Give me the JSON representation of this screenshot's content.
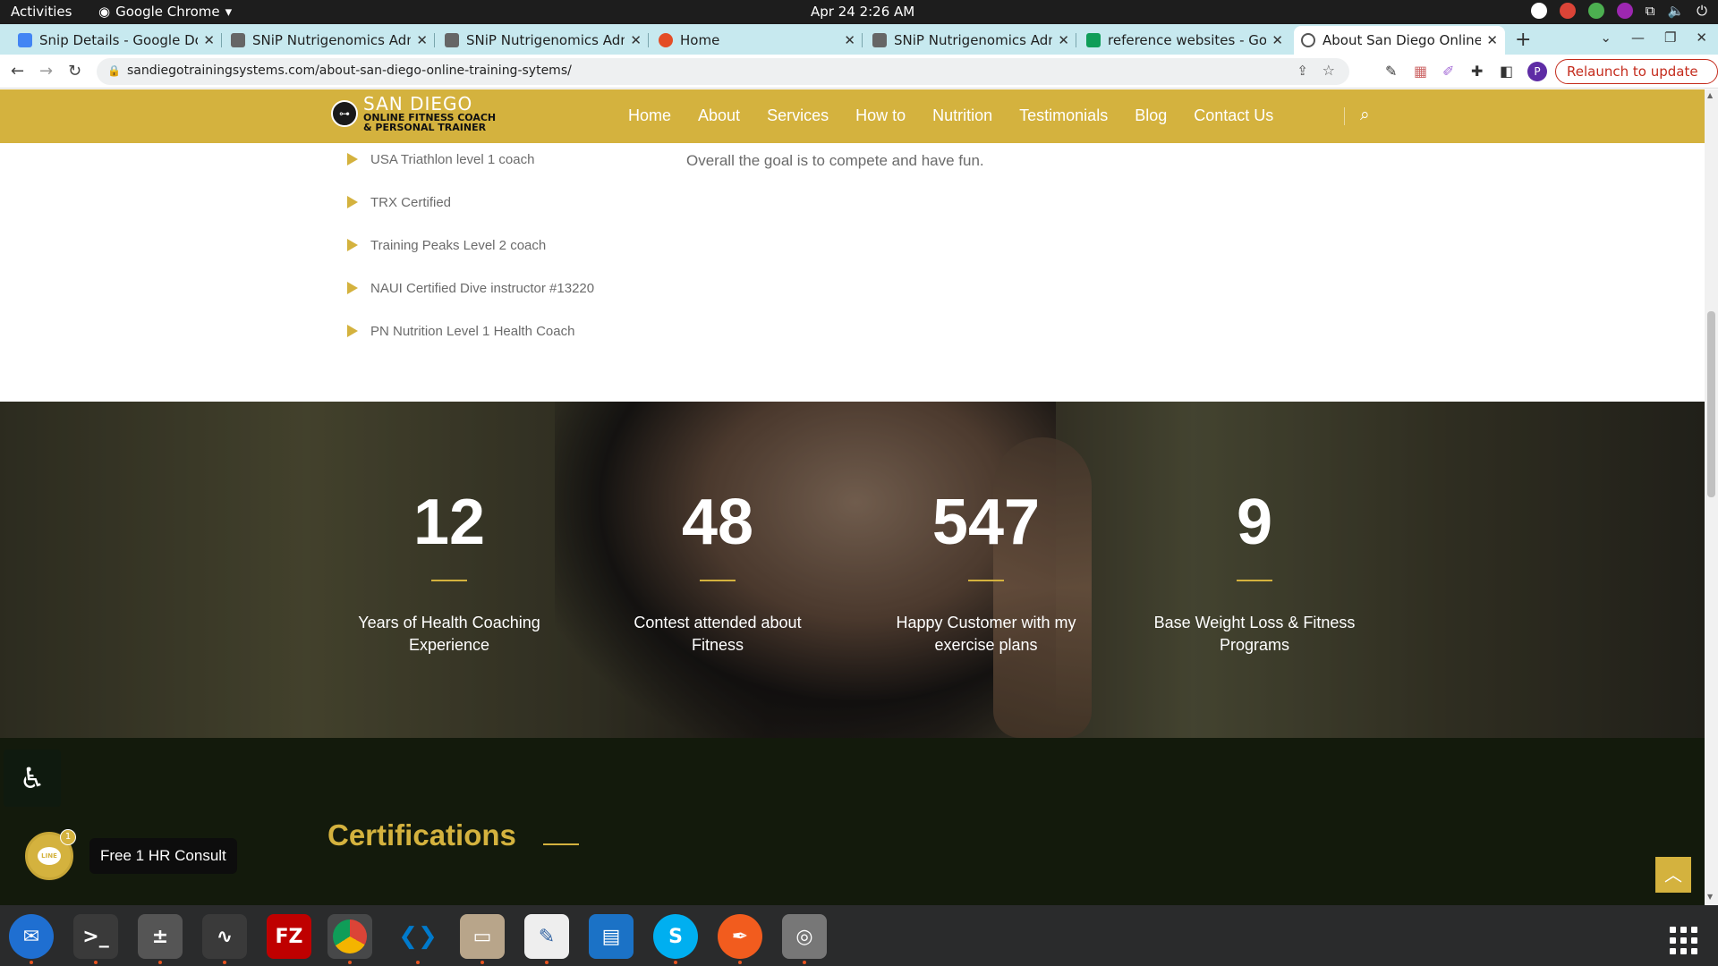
{
  "system_bar": {
    "activities": "Activities",
    "app_name": "Google Chrome",
    "datetime": "Apr 24  2:26 AM"
  },
  "tabs": [
    {
      "title": "Snip Details - Google Doc",
      "icon_color": "#4285f4",
      "icon": "docs-icon"
    },
    {
      "title": "SNiP Nutrigenomics Adm",
      "icon_color": "#666666",
      "icon": "snip-icon"
    },
    {
      "title": "SNiP Nutrigenomics Adm",
      "icon_color": "#666666",
      "icon": "snip-icon"
    },
    {
      "title": "Home",
      "icon_color": "#e44d26",
      "icon": "home-site-icon"
    },
    {
      "title": "SNiP Nutrigenomics Adm",
      "icon_color": "#666666",
      "icon": "snip-icon"
    },
    {
      "title": "reference websites - Goog",
      "icon_color": "#0f9d58",
      "icon": "sheets-icon"
    },
    {
      "title": "About San Diego Online T",
      "icon_color": "#555555",
      "icon": "globe-icon",
      "active": true
    }
  ],
  "address_bar": {
    "url": "sandiegotrainingsystems.com/about-san-diego-online-training-sytems/",
    "profile_initial": "P",
    "relaunch": "Relaunch to update"
  },
  "site": {
    "logo_name": "SAN DIEGO",
    "logo_sub1": "ONLINE FITNESS COACH",
    "logo_sub2": "& PERSONAL TRAINER",
    "menu": [
      "Home",
      "About",
      "Services",
      "How to",
      "Nutrition",
      "Testimonials",
      "Blog",
      "Contact Us"
    ],
    "accent_color": "#d4b23e"
  },
  "credentials": [
    "USA Triathlon level 1 coach",
    "TRX Certified",
    "Training Peaks Level 2 coach",
    "NAUI Certified Dive instructor #13220",
    "PN Nutrition Level 1 Health Coach"
  ],
  "goal_text": "Overall the goal is to compete and have fun.",
  "stats": [
    {
      "number": "12",
      "label": "Years of Health Coaching Experience"
    },
    {
      "number": "48",
      "label": "Contest attended about Fitness"
    },
    {
      "number": "547",
      "label": "Happy Customer with my exercise plans"
    },
    {
      "number": "9",
      "label": "Base Weight Loss & Fitness Programs"
    }
  ],
  "certifications_title": "Certifications",
  "widgets": {
    "line_label": "LINE",
    "line_badge": "1",
    "consult": "Free 1 HR Consult"
  },
  "dock": [
    {
      "name": "thunderbird-icon",
      "color": "#1f6fd1",
      "glyph": "✉"
    },
    {
      "name": "terminal-icon",
      "color": "#3a3a3a",
      "glyph": ">_"
    },
    {
      "name": "calculator-icon",
      "color": "#f0a500",
      "glyph": "±"
    },
    {
      "name": "system-monitor-icon",
      "color": "#3a3a3a",
      "glyph": "∿"
    },
    {
      "name": "filezilla-icon",
      "color": "#bf0000",
      "glyph": "FZ"
    },
    {
      "name": "chrome-icon",
      "color": "#db4437",
      "glyph": "◉"
    },
    {
      "name": "vscode-icon",
      "color": "#007acc",
      "glyph": "❮❯"
    },
    {
      "name": "files-icon",
      "color": "#b8a58a",
      "glyph": "▭"
    },
    {
      "name": "text-editor-icon",
      "color": "#f2f2f2",
      "glyph": "✎"
    },
    {
      "name": "libreoffice-writer-icon",
      "color": "#1b72c6",
      "glyph": "▤"
    },
    {
      "name": "skype-icon",
      "color": "#00aff0",
      "glyph": "S"
    },
    {
      "name": "inkscape-icon",
      "color": "#f25c1e",
      "glyph": "✒"
    },
    {
      "name": "disk-icon",
      "color": "#888888",
      "glyph": "◎"
    }
  ]
}
